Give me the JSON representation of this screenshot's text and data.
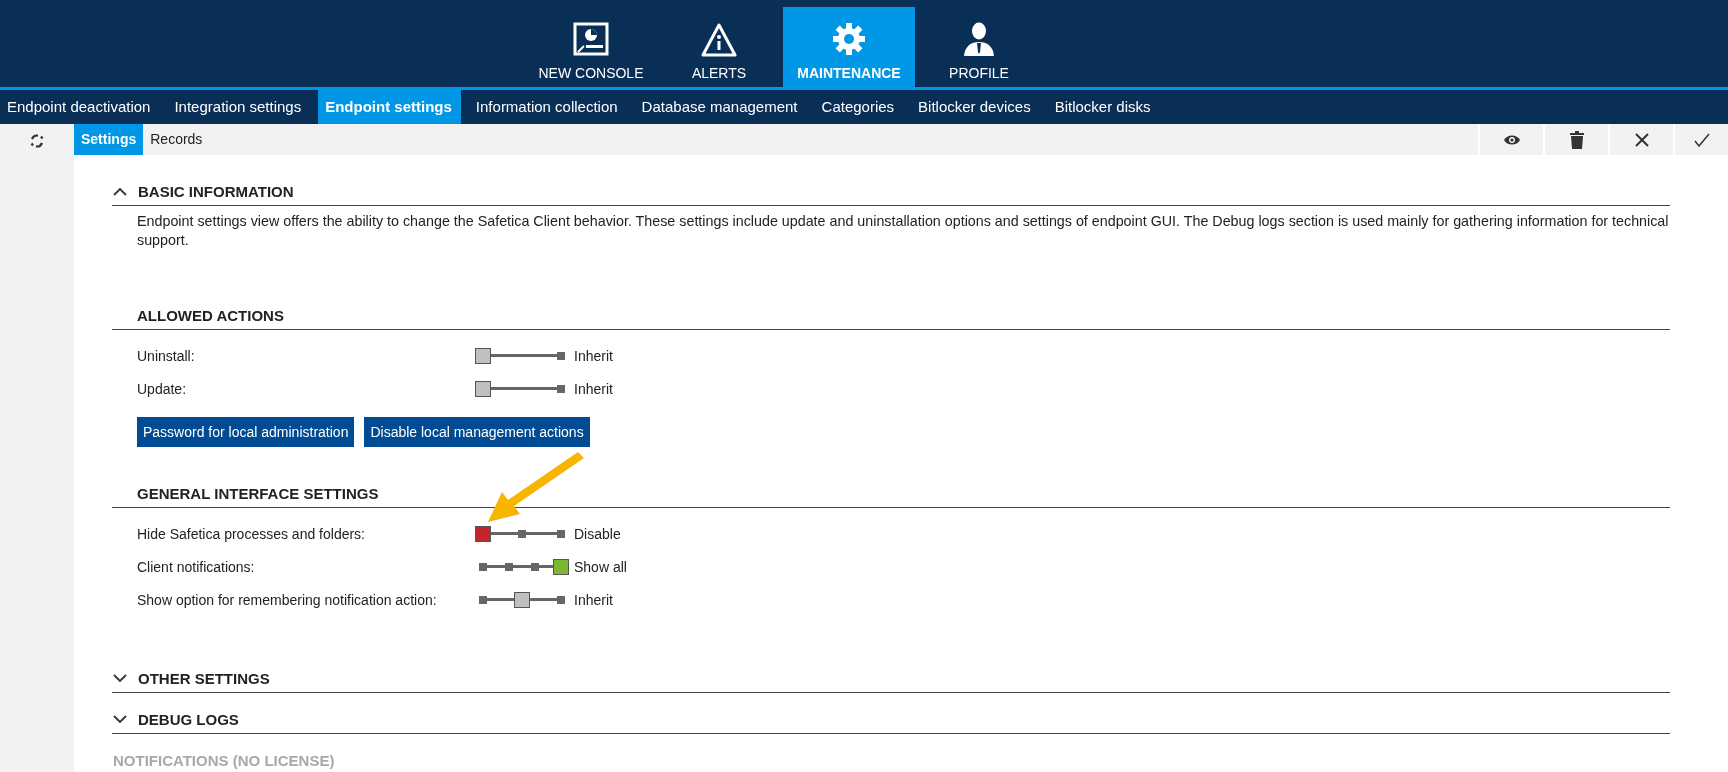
{
  "top_nav": [
    {
      "label": "NEW CONSOLE",
      "kind": "console",
      "selected": false
    },
    {
      "label": "ALERTS",
      "kind": "alert",
      "selected": false
    },
    {
      "label": "MAINTENANCE",
      "kind": "gear",
      "selected": true
    },
    {
      "label": "PROFILE",
      "kind": "user",
      "selected": false
    }
  ],
  "sub_nav": [
    {
      "label": "Endpoint deactivation",
      "selected": false
    },
    {
      "label": "Integration settings",
      "selected": false
    },
    {
      "label": "Endpoint settings",
      "selected": true
    },
    {
      "label": "Information collection",
      "selected": false
    },
    {
      "label": "Database management",
      "selected": false
    },
    {
      "label": "Categories",
      "selected": false
    },
    {
      "label": "Bitlocker devices",
      "selected": false
    },
    {
      "label": "Bitlocker disks",
      "selected": false
    }
  ],
  "view_tabs": [
    {
      "label": "Settings",
      "selected": true
    },
    {
      "label": "Records",
      "selected": false
    }
  ],
  "sections": [
    {
      "title": "BASIC INFORMATION",
      "expanded": true,
      "disabled": false,
      "description": "Endpoint settings view offers the ability to change the Safetica Client behavior. These settings include update and uninstallation options and settings of endpoint GUI. The Debug logs section is used mainly for gathering information for technical support.",
      "subsections": [
        {
          "title": "ALLOWED ACTIONS",
          "settings": [
            {
              "label": "Uninstall:",
              "kind": "two-step",
              "level": 0,
              "color": "#c0c0c0",
              "value": "Inherit"
            },
            {
              "label": "Update:",
              "kind": "two-step",
              "level": 0,
              "color": "#c0c0c0",
              "value": "Inherit"
            }
          ],
          "buttons": [
            "Password for local administration",
            "Disable local management actions"
          ]
        },
        {
          "title": "GENERAL INTERFACE SETTINGS",
          "settings": [
            {
              "label": "Hide Safetica processes and folders:",
              "kind": "three-step",
              "level": 0,
              "color": "#c0262b",
              "value": "Disable"
            },
            {
              "label": "Client notifications:",
              "kind": "four-step",
              "level": 1,
              "color": "#7cb82f",
              "value": "Show all"
            },
            {
              "label": "Show option for remembering notification action:",
              "kind": "three-step",
              "level": 0.5,
              "color": "#c0c0c0",
              "value": "Inherit"
            }
          ]
        }
      ]
    },
    {
      "title": "OTHER SETTINGS",
      "expanded": false,
      "disabled": false
    },
    {
      "title": "DEBUG LOGS",
      "expanded": false,
      "disabled": false
    },
    {
      "title": "NOTIFICATIONS (NO LICENSE)",
      "disabled": true
    }
  ]
}
